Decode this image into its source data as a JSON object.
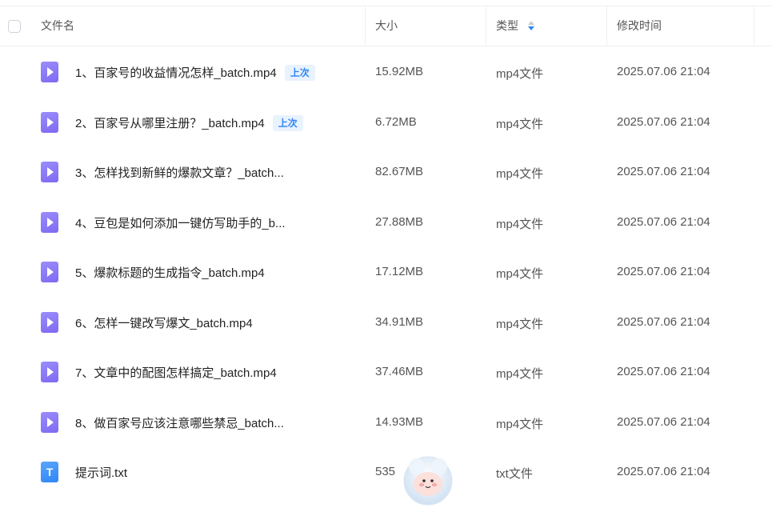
{
  "header": {
    "name": "文件名",
    "size": "大小",
    "type": "类型",
    "modified": "修改时间"
  },
  "colors": {
    "video_icon": "#8b7cf6",
    "text_icon": "#3b8ef7",
    "badge_text": "#2f86f5",
    "badge_bg": "#e9f2ff",
    "sort_active": "#2f86f5"
  },
  "files": [
    {
      "name": "1、百家号的收益情况怎样_batch.mp4",
      "badge": "上次",
      "size": "15.92MB",
      "type": "mp4文件",
      "modified": "2025.07.06 21:04",
      "icon": "video-file-icon"
    },
    {
      "name": "2、百家号从哪里注册？_batch.mp4",
      "badge": "上次",
      "size": "6.72MB",
      "type": "mp4文件",
      "modified": "2025.07.06 21:04",
      "icon": "video-file-icon"
    },
    {
      "name": "3、怎样找到新鲜的爆款文章？_batch...",
      "badge": "",
      "size": "82.67MB",
      "type": "mp4文件",
      "modified": "2025.07.06 21:04",
      "icon": "video-file-icon"
    },
    {
      "name": "4、豆包是如何添加一键仿写助手的_b...",
      "badge": "",
      "size": "27.88MB",
      "type": "mp4文件",
      "modified": "2025.07.06 21:04",
      "icon": "video-file-icon"
    },
    {
      "name": "5、爆款标题的生成指令_batch.mp4",
      "badge": "",
      "size": "17.12MB",
      "type": "mp4文件",
      "modified": "2025.07.06 21:04",
      "icon": "video-file-icon"
    },
    {
      "name": "6、怎样一键改写爆文_batch.mp4",
      "badge": "",
      "size": "34.91MB",
      "type": "mp4文件",
      "modified": "2025.07.06 21:04",
      "icon": "video-file-icon"
    },
    {
      "name": "7、文章中的配图怎样搞定_batch.mp4",
      "badge": "",
      "size": "37.46MB",
      "type": "mp4文件",
      "modified": "2025.07.06 21:04",
      "icon": "video-file-icon"
    },
    {
      "name": "8、做百家号应该注意哪些禁忌_batch...",
      "badge": "",
      "size": "14.93MB",
      "type": "mp4文件",
      "modified": "2025.07.06 21:04",
      "icon": "video-file-icon"
    },
    {
      "name": "提示词.txt",
      "badge": "",
      "size": "535",
      "type": "txt文件",
      "modified": "2025.07.06 21:04",
      "icon": "text-file-icon",
      "icon_letter": "T"
    }
  ],
  "mascot": {
    "icon": "assistant-mascot-icon"
  }
}
